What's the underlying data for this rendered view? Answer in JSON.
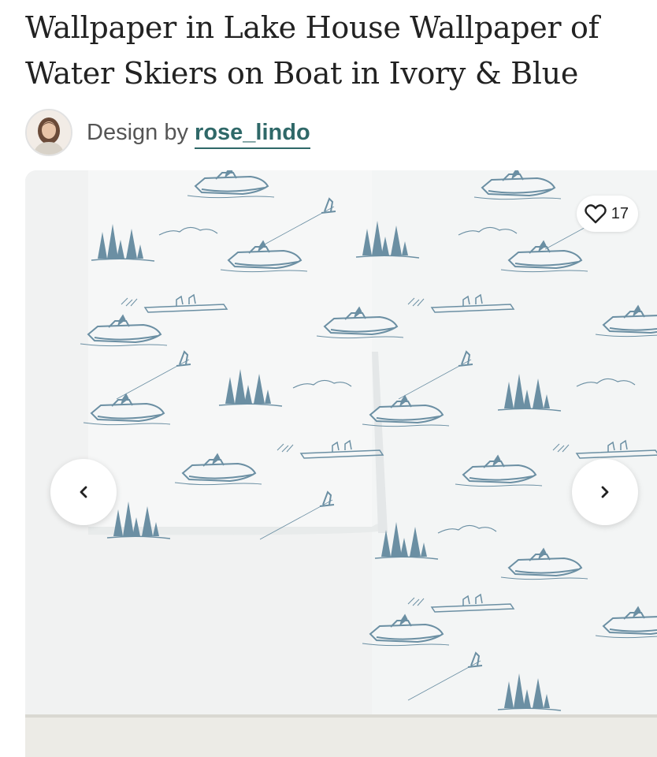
{
  "product": {
    "title": "Wallpaper in Lake House Wallpaper of Water Skiers on Boat in Ivory & Blue"
  },
  "designer": {
    "prefix": "Design by",
    "name": "rose_lindo"
  },
  "gallery": {
    "like_count": "17",
    "pattern_color": "#6b8fa3",
    "background_color": "#f1f2f2",
    "icons": {
      "prev": "chevron-left-icon",
      "next": "chevron-right-icon",
      "favorite": "heart-outline-icon"
    }
  },
  "colors": {
    "link": "#2f6868",
    "title_text": "#222222"
  }
}
